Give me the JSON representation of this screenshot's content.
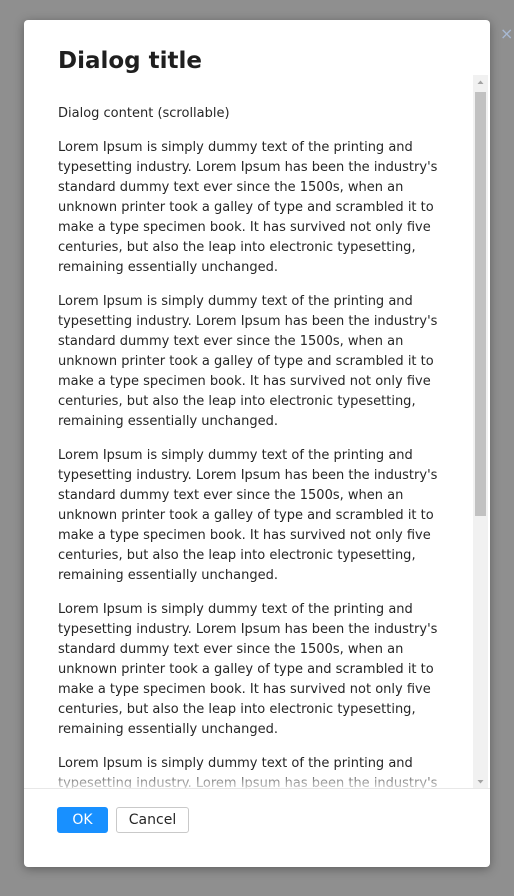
{
  "dialog": {
    "title": "Dialog title",
    "content_heading": "Dialog content (scrollable)",
    "paragraphs": [
      "Lorem Ipsum is simply dummy text of the printing and typesetting industry. Lorem Ipsum has been the industry's standard dummy text ever since the 1500s, when an unknown printer took a galley of type and scrambled it to make a type specimen book. It has survived not only five centuries, but also the leap into electronic typesetting, remaining essentially unchanged.",
      "Lorem Ipsum is simply dummy text of the printing and typesetting industry. Lorem Ipsum has been the industry's standard dummy text ever since the 1500s, when an unknown printer took a galley of type and scrambled it to make a type specimen book. It has survived not only five centuries, but also the leap into electronic typesetting, remaining essentially unchanged.",
      "Lorem Ipsum is simply dummy text of the printing and typesetting industry. Lorem Ipsum has been the industry's standard dummy text ever since the 1500s, when an unknown printer took a galley of type and scrambled it to make a type specimen book. It has survived not only five centuries, but also the leap into electronic typesetting, remaining essentially unchanged.",
      "Lorem Ipsum is simply dummy text of the printing and typesetting industry. Lorem Ipsum has been the industry's standard dummy text ever since the 1500s, when an unknown printer took a galley of type and scrambled it to make a type specimen book. It has survived not only five centuries, but also the leap into electronic typesetting, remaining essentially unchanged.",
      "Lorem Ipsum is simply dummy text of the printing and typesetting industry. Lorem Ipsum has been the industry's"
    ],
    "ok_label": "OK",
    "cancel_label": "Cancel",
    "close_icon_glyph": "×"
  },
  "colors": {
    "primary": "#1890ff",
    "backdrop": "#8f8f8f",
    "scroll_thumb": "#c1c1c1"
  },
  "icons": {
    "close": "close-icon",
    "scroll_up": "scroll-up-arrow-icon",
    "scroll_down": "scroll-down-arrow-icon"
  }
}
